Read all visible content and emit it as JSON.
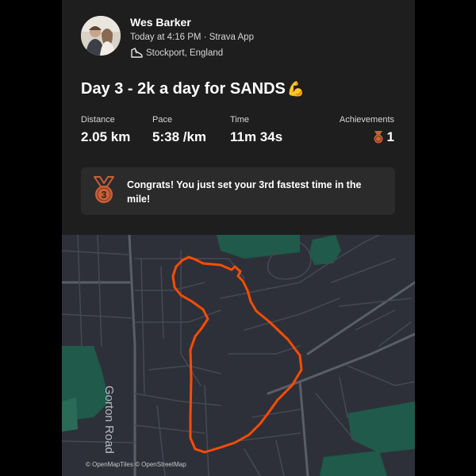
{
  "header": {
    "athlete_name": "Wes Barker",
    "meta": "Today at 4:16 PM · Strava App",
    "location": "Stockport, England",
    "avatar_icon": "profile-photo",
    "location_icon": "shoe-icon"
  },
  "activity": {
    "title": "Day 3 - 2k a day for SANDS",
    "title_emoji": "💪"
  },
  "stats": {
    "distance": {
      "label": "Distance",
      "value": "2.05 km"
    },
    "pace": {
      "label": "Pace",
      "value": "5:38 /km"
    },
    "time": {
      "label": "Time",
      "value": "11m 34s"
    },
    "achievements": {
      "label": "Achievements",
      "value": "1",
      "icon": "medal-icon"
    }
  },
  "banner": {
    "text": "Congrats! You just set your 3rd fastest time in the mile!",
    "medal_number": "3",
    "medal_color": "#c8603a"
  },
  "map": {
    "road_label": "Gorton Road",
    "attribution": "© OpenMapTiles © OpenStreetMap",
    "route_color": "#fc4c02",
    "background_color": "#2d3039",
    "park_color": "#1f5a4a"
  }
}
